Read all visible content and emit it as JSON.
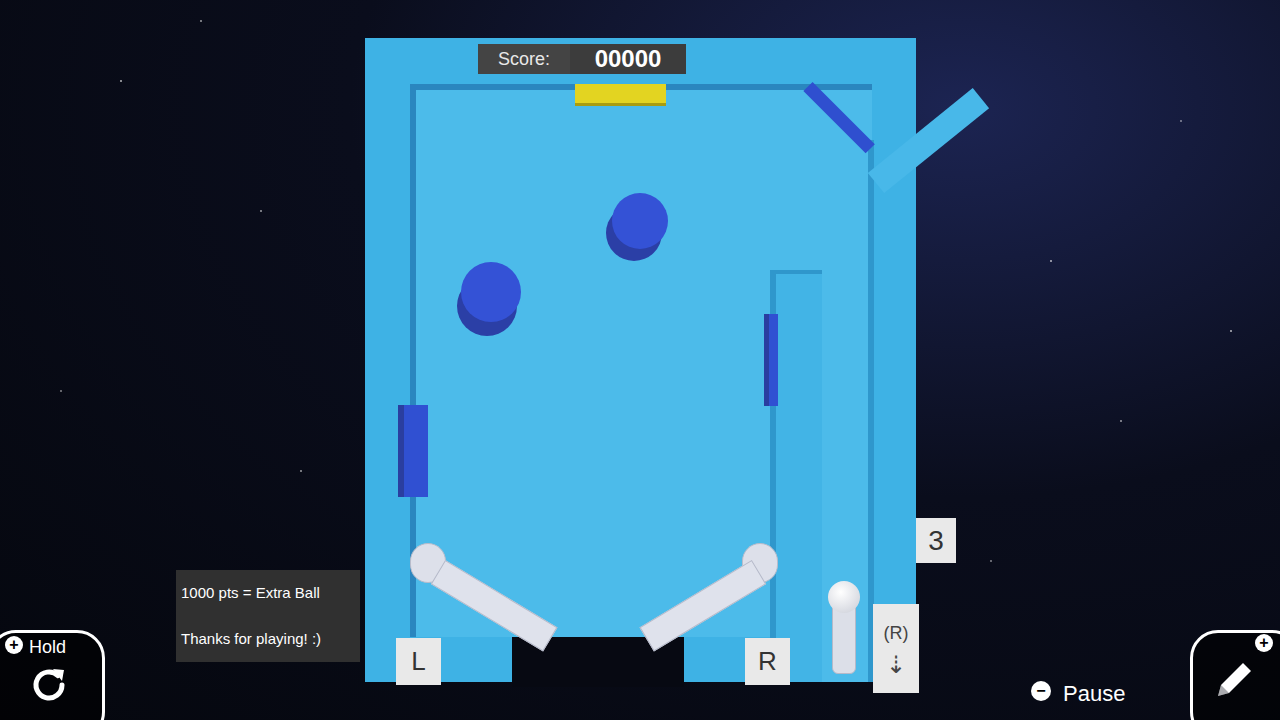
{
  "score": {
    "label": "Score:",
    "value": "00000"
  },
  "balls_left": "3",
  "flipper_keys": {
    "left": "L",
    "right": "R"
  },
  "launch_hint": {
    "key": "(R)",
    "arrow": "⇣"
  },
  "info_panel": {
    "lines": [
      "1000 pts = Extra Ball",
      "Thanks for playing! :)"
    ]
  },
  "hold_button": {
    "plus": "+",
    "label": "Hold"
  },
  "pause": {
    "symbol": "−",
    "label": "Pause"
  },
  "edit_button": {
    "plus": "+"
  }
}
